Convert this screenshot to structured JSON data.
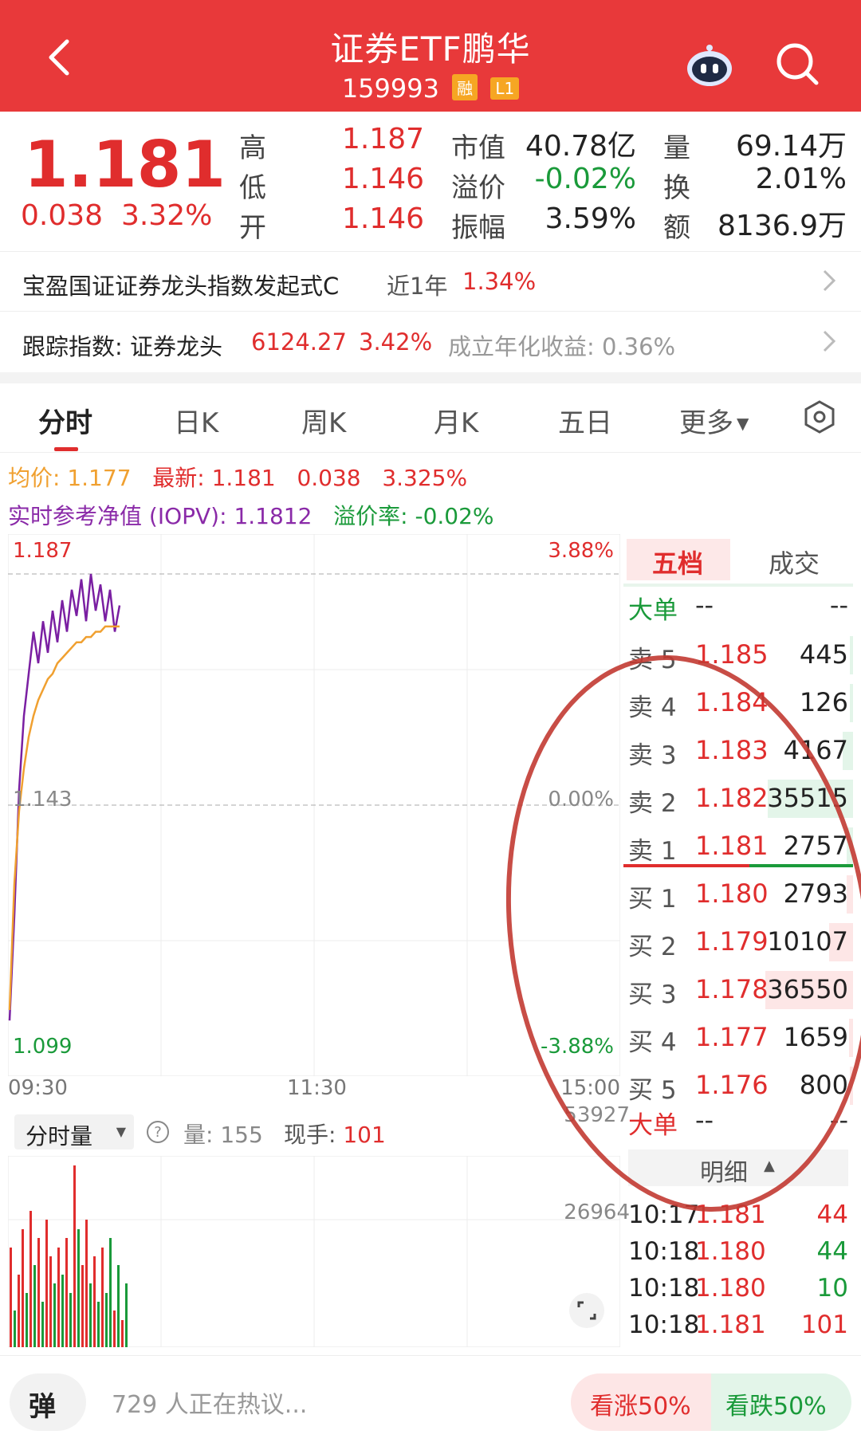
{
  "header": {
    "title": "证券ETF鹏华",
    "code": "159993",
    "tags": [
      "融",
      "L1"
    ]
  },
  "quote": {
    "price": "1.181",
    "change": "0.038",
    "change_pct": "3.32%",
    "stats": [
      {
        "label": "高",
        "value": "1.187"
      },
      {
        "label": "低",
        "value": "1.146"
      },
      {
        "label": "开",
        "value": "1.146"
      },
      {
        "label": "市值",
        "value": "40.78亿"
      },
      {
        "label": "溢价",
        "value": "-0.02%"
      },
      {
        "label": "振幅",
        "value": "3.59%"
      },
      {
        "label": "量",
        "value": "69.14万"
      },
      {
        "label": "换",
        "value": "2.01%"
      },
      {
        "label": "额",
        "value": "8136.9万"
      }
    ]
  },
  "fund_row": {
    "name": "宝盈国证证券龙头指数发起式C",
    "period": "近1年",
    "return": "1.34%"
  },
  "index_row": {
    "label": "跟踪指数: 证券龙头",
    "value": "6124.27",
    "pct": "3.42%",
    "extra": "成立年化收益: 0.36%"
  },
  "tabs": [
    "分时",
    "日K",
    "周K",
    "月K",
    "五日",
    "更多"
  ],
  "avg_row": {
    "avg_label": "均价:",
    "avg_value": "1.177",
    "latest_label": "最新:",
    "latest_value": "1.181",
    "latest_change": "0.038",
    "latest_pct": "3.325%"
  },
  "iopv_row": {
    "label": "实时参考净值 (IOPV):",
    "value": "1.1812",
    "premium_label": "溢价率:",
    "premium_value": "-0.02%"
  },
  "chart_data": {
    "type": "line",
    "x": [
      "09:30",
      "11:30",
      "15:00"
    ],
    "y_left_ticks": [
      "1.187",
      "1.143",
      "1.099"
    ],
    "y_right_ticks": [
      "3.88%",
      "0.00%",
      "-3.88%"
    ],
    "ylim": [
      1.099,
      1.187
    ],
    "base": 1.143,
    "series": [
      {
        "values": [
          1.102,
          1.122,
          1.146,
          1.16,
          1.168,
          1.176,
          1.17,
          1.178,
          1.172,
          1.18,
          1.174,
          1.182,
          1.176,
          1.184,
          1.179,
          1.186,
          1.178,
          1.187,
          1.18,
          1.185,
          1.178,
          1.184,
          1.176,
          1.181
        ]
      },
      {
        "values": [
          1.104,
          1.128,
          1.142,
          1.15,
          1.156,
          1.16,
          1.163,
          1.165,
          1.167,
          1.168,
          1.17,
          1.171,
          1.172,
          1.173,
          1.174,
          1.174,
          1.175,
          1.175,
          1.176,
          1.176,
          1.177,
          1.177,
          1.177,
          1.177
        ]
      }
    ],
    "line_colors": [
      "#7a1fa2",
      "#f0a030"
    ]
  },
  "volume": {
    "dropdown": "分时量",
    "vol_label": "量:",
    "vol_value": "155",
    "hand_label": "现手:",
    "hand_value": "101",
    "ticks": [
      "53927",
      "26964"
    ],
    "bars": [
      0.55,
      0.2,
      0.4,
      0.65,
      0.3,
      0.75,
      0.45,
      0.6,
      0.25,
      0.7,
      0.5,
      0.35,
      0.55,
      0.4,
      0.6,
      0.3,
      1.0,
      0.65,
      0.45,
      0.7,
      0.35,
      0.5,
      0.25,
      0.55,
      0.3,
      0.6,
      0.2,
      0.45,
      0.15,
      0.35
    ],
    "bar_colors": [
      "r",
      "g",
      "r",
      "r",
      "g",
      "r",
      "g",
      "r",
      "g",
      "r",
      "r",
      "g",
      "r",
      "g",
      "r",
      "g",
      "r",
      "g",
      "r",
      "r",
      "g",
      "r",
      "g",
      "r",
      "g",
      "g",
      "r",
      "g",
      "r",
      "g"
    ]
  },
  "book": {
    "tabs": [
      "五档",
      "成交"
    ],
    "big_order": {
      "label": "大单",
      "a": "--",
      "b": "--"
    },
    "sells": [
      {
        "label": "卖 5",
        "price": "1.185",
        "vol": "445"
      },
      {
        "label": "卖 4",
        "price": "1.184",
        "vol": "126"
      },
      {
        "label": "卖 3",
        "price": "1.183",
        "vol": "4167"
      },
      {
        "label": "卖 2",
        "price": "1.182",
        "vol": "35515"
      },
      {
        "label": "卖 1",
        "price": "1.181",
        "vol": "2757"
      }
    ],
    "buys": [
      {
        "label": "买 1",
        "price": "1.180",
        "vol": "2793"
      },
      {
        "label": "买 2",
        "price": "1.179",
        "vol": "10107"
      },
      {
        "label": "买 3",
        "price": "1.178",
        "vol": "36550"
      },
      {
        "label": "买 4",
        "price": "1.177",
        "vol": "1659"
      },
      {
        "label": "买 5",
        "price": "1.176",
        "vol": "800"
      }
    ],
    "big_order2": {
      "label": "大单",
      "a": "--",
      "b": "--"
    },
    "detail_label": "明细",
    "details": [
      {
        "time": "10:17",
        "price": "1.181",
        "vol": "44",
        "color": "red"
      },
      {
        "time": "10:18",
        "price": "1.180",
        "vol": "44",
        "color": "green"
      },
      {
        "time": "10:18",
        "price": "1.180",
        "vol": "10",
        "color": "green"
      },
      {
        "time": "10:18",
        "price": "1.181",
        "vol": "101",
        "color": "red"
      }
    ]
  },
  "bottom": {
    "danmu": "弹",
    "placeholder": "729 人正在热议...",
    "up": "看涨50%",
    "down": "看跌50%"
  },
  "colors": {
    "brand": "#e8393a",
    "up": "#e02d2d",
    "down": "#1a9a3a"
  }
}
